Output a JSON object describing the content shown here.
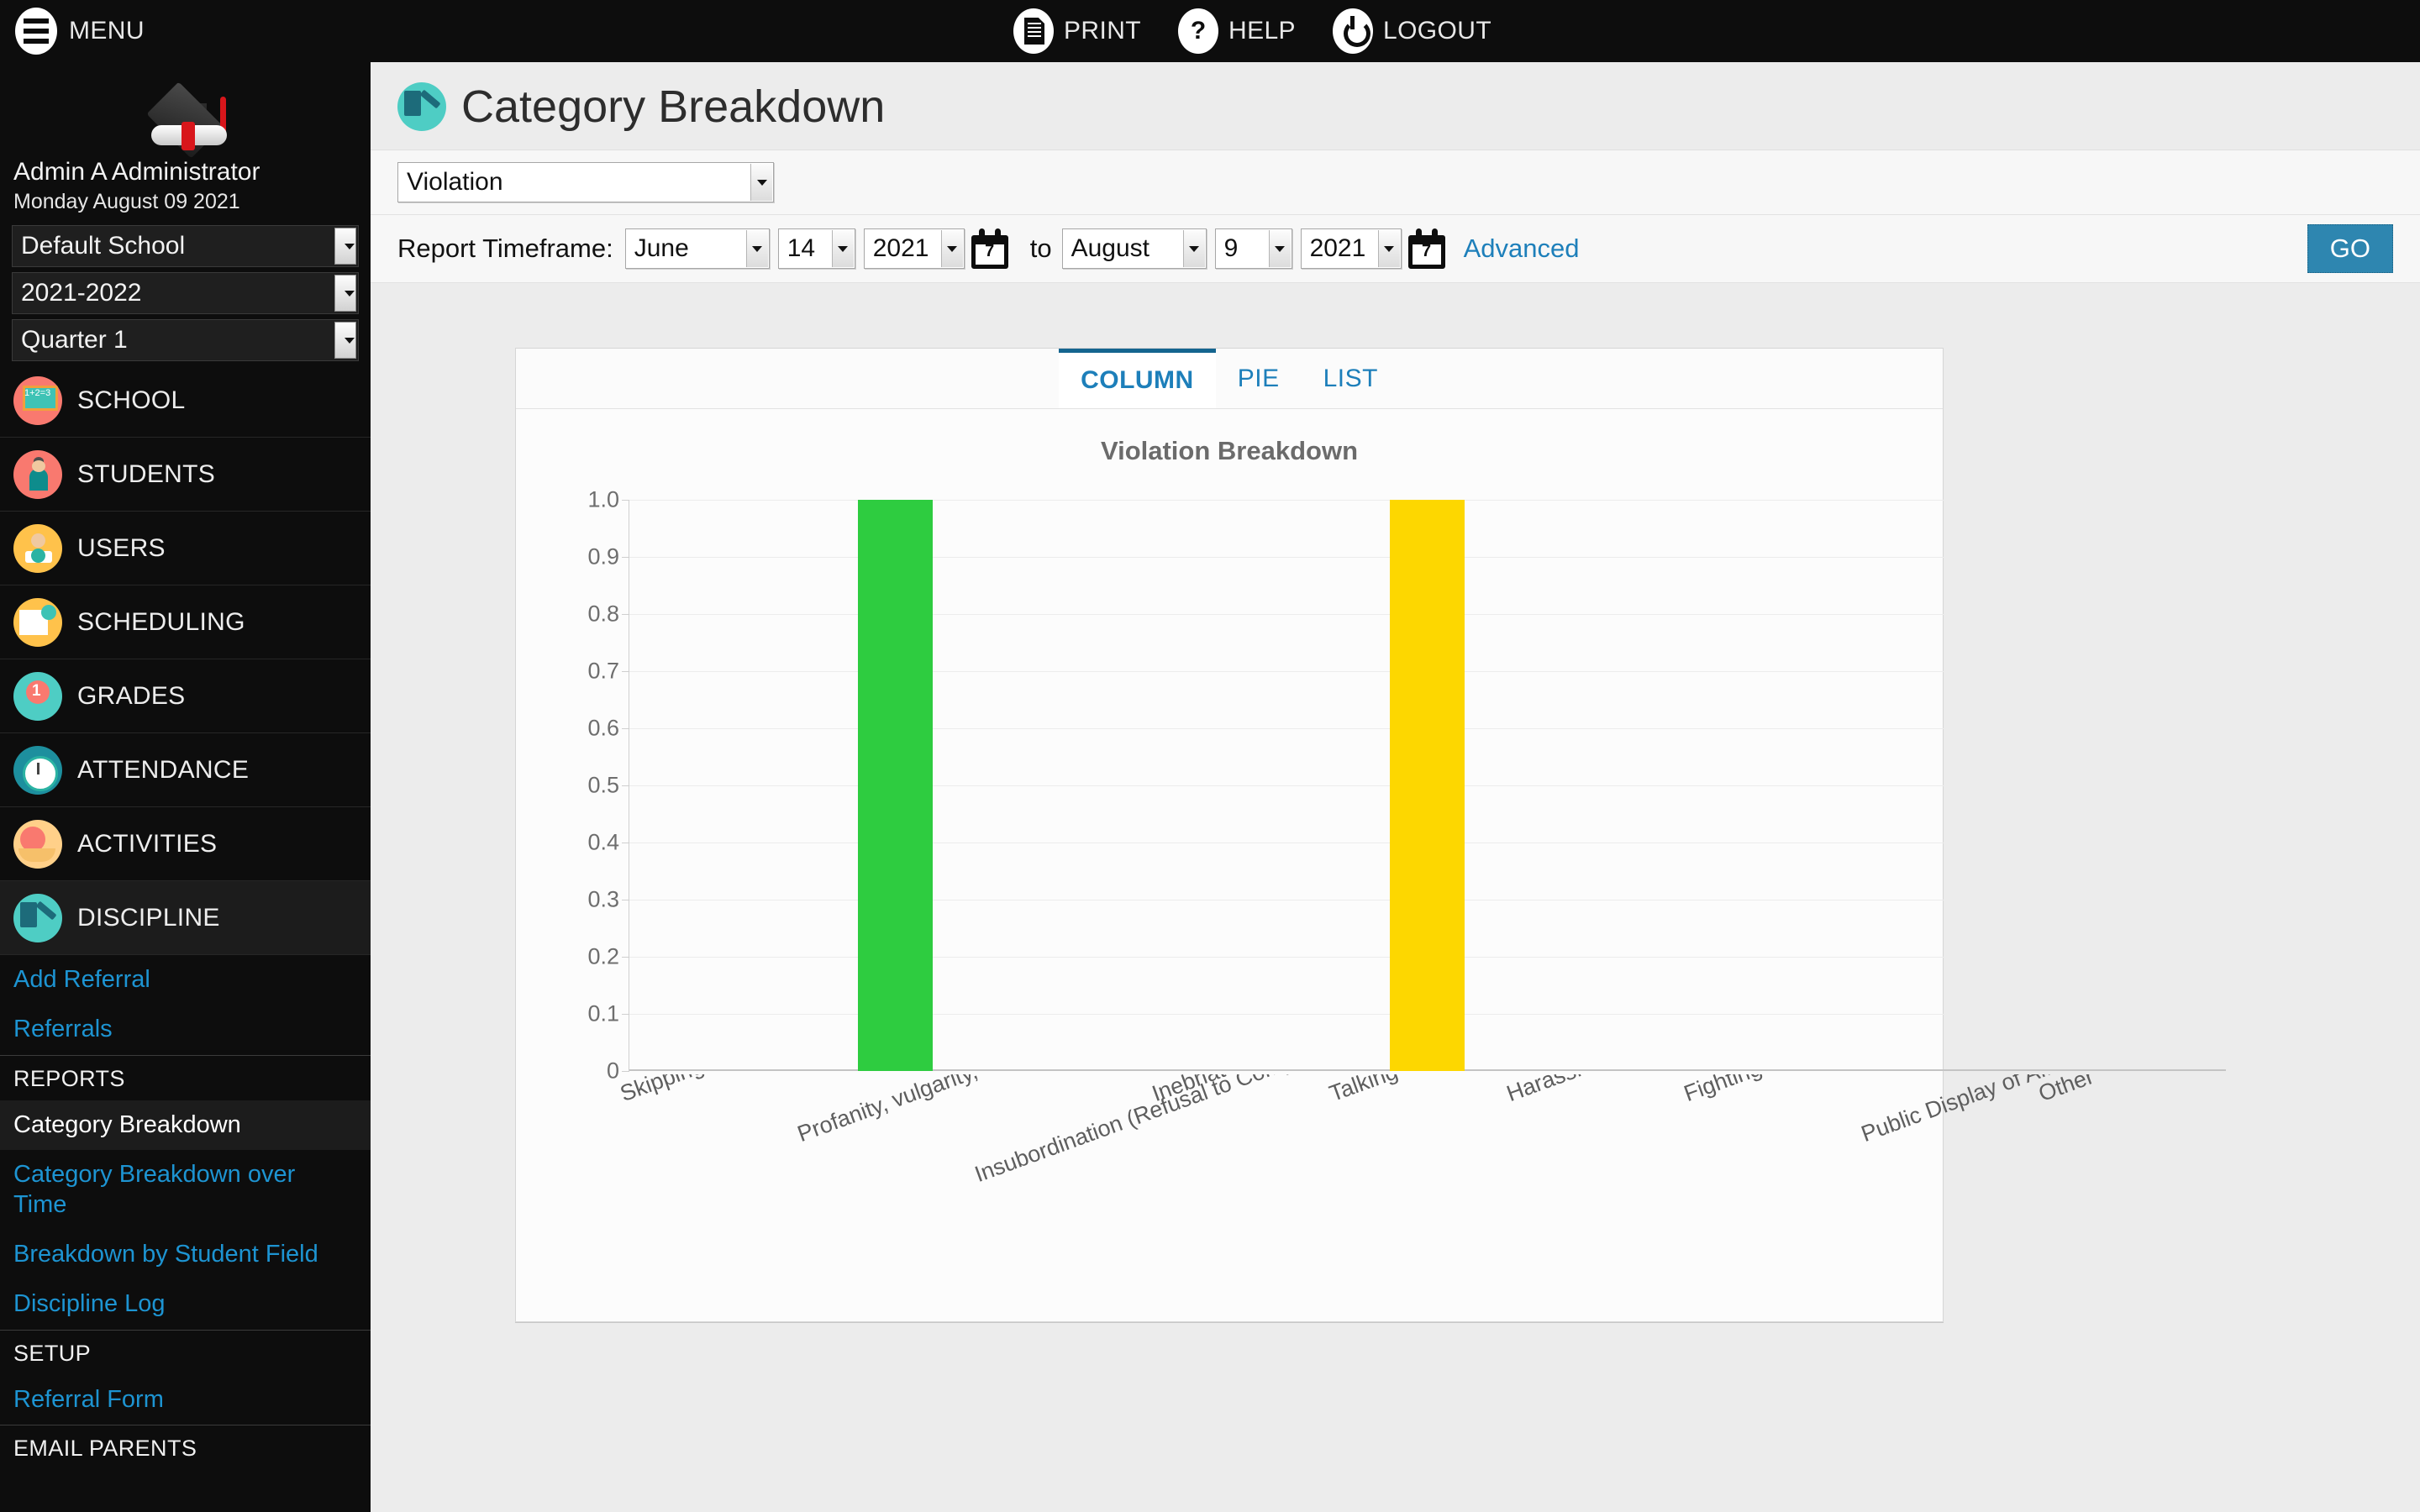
{
  "topbar": {
    "menu_label": "MENU",
    "items": [
      {
        "label": "PRINT",
        "icon": "printer-icon"
      },
      {
        "label": "HELP",
        "icon": "question-mark-icon"
      },
      {
        "label": "LOGOUT",
        "icon": "power-icon"
      }
    ]
  },
  "sidebar": {
    "user_name": "Admin A Administrator",
    "user_date": "Monday August 09 2021",
    "selects": [
      {
        "name": "school",
        "value": "Default School"
      },
      {
        "name": "year",
        "value": "2021-2022"
      },
      {
        "name": "marking-period",
        "value": "Quarter 1"
      }
    ],
    "nav": [
      {
        "label": "SCHOOL",
        "icon": "chalkboard-icon"
      },
      {
        "label": "STUDENTS",
        "icon": "students-icon"
      },
      {
        "label": "USERS",
        "icon": "user-laptop-icon"
      },
      {
        "label": "SCHEDULING",
        "icon": "calendar-clock-icon"
      },
      {
        "label": "GRADES",
        "icon": "award-ribbon-icon"
      },
      {
        "label": "ATTENDANCE",
        "icon": "alarm-clock-icon"
      },
      {
        "label": "ACTIVITIES",
        "icon": "basketball-icon"
      },
      {
        "label": "DISCIPLINE",
        "icon": "gavel-book-icon"
      }
    ],
    "discipline_links": [
      "Add Referral",
      "Referrals"
    ],
    "reports_heading": "REPORTS",
    "reports_links": [
      "Category Breakdown",
      "Category Breakdown over Time",
      "Breakdown by Student Field",
      "Discipline Log"
    ],
    "setup_heading": "SETUP",
    "setup_links": [
      "Referral Form"
    ],
    "email_heading": "EMAIL PARENTS"
  },
  "page": {
    "title": "Category Breakdown",
    "icon": "gavel-book-icon"
  },
  "filters": {
    "category_select": "Violation",
    "timeframe_label": "Report Timeframe:",
    "start": {
      "month": "June",
      "day": "14",
      "year": "2021"
    },
    "to_label": "to",
    "end": {
      "month": "August",
      "day": "9",
      "year": "2021"
    },
    "calendar_day_glyph": "7",
    "advanced_label": "Advanced",
    "go_label": "GO"
  },
  "chart_tabs": [
    {
      "label": "COLUMN",
      "active": true
    },
    {
      "label": "PIE",
      "active": false
    },
    {
      "label": "LIST",
      "active": false
    }
  ],
  "colors": {
    "accent_blue": "#1d7fba",
    "go_button": "#2e86b0",
    "bar_green": "#2ecc40",
    "bar_yellow": "#fdd700",
    "sidebar_bg": "#0d0d0d"
  },
  "chart_data": {
    "type": "bar",
    "title": "Violation Breakdown",
    "xlabel": "",
    "ylabel": "",
    "ylim": [
      0,
      1.0
    ],
    "yticks": [
      "0",
      "0.1",
      "0.2",
      "0.3",
      "0.4",
      "0.5",
      "0.6",
      "0.7",
      "0.8",
      "0.9",
      "1.0"
    ],
    "grid": true,
    "legend": "none",
    "categories": [
      "Skipping Class",
      "Profanity, vulgarity, offensive language",
      "Insubordination (Refusal to Comply, Disrespectful Behavior)",
      "Inebriated (Alcohol or Drugs)",
      "Talking out of Turn",
      "Harassment",
      "Fighting",
      "Public Display of Affection",
      "Other"
    ],
    "values": [
      0,
      1,
      0,
      0,
      1,
      0,
      0,
      0,
      0
    ],
    "bar_colors": [
      "#4472c4",
      "#2ecc40",
      "#ff7f0e",
      "#9467bd",
      "#fdd700",
      "#8c564b",
      "#e377c2",
      "#7f7f7f",
      "#17becf"
    ]
  }
}
